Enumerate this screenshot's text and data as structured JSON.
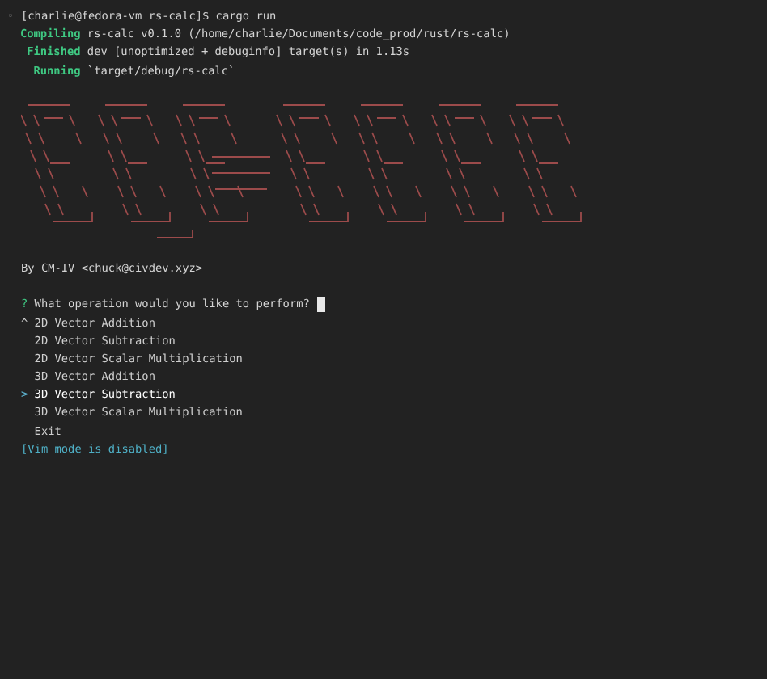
{
  "prompt": {
    "marker": "◦",
    "text": "[charlie@fedora-vm rs-calc]$ cargo run"
  },
  "build_log": [
    {
      "status": "Compiling",
      "message": "rs-calc v0.1.0 (/home/charlie/Documents/code_prod/rust/rs-calc)"
    },
    {
      "status": "Finished",
      "message": "dev [unoptimized + debuginfo] target(s) in 1.13s"
    },
    {
      "status": "Running",
      "message": "`target/debug/rs-calc`"
    }
  ],
  "author": "By CM-IV <chuck@civdev.xyz>",
  "question": {
    "mark": "?",
    "text": "What operation would you like to perform?"
  },
  "options": [
    {
      "marker": "^",
      "label": "2D Vector Addition",
      "selected": false
    },
    {
      "label": "2D Vector Subtraction",
      "selected": false
    },
    {
      "label": "2D Vector Scalar Multiplication",
      "selected": false
    },
    {
      "label": "3D Vector Addition",
      "selected": false
    },
    {
      "marker": ">",
      "label": "3D Vector Subtraction",
      "selected": true
    },
    {
      "label": "3D Vector Scalar Multiplication",
      "selected": false
    },
    {
      "label": "Exit",
      "selected": false
    }
  ],
  "vim_status": "[Vim mode is disabled]"
}
